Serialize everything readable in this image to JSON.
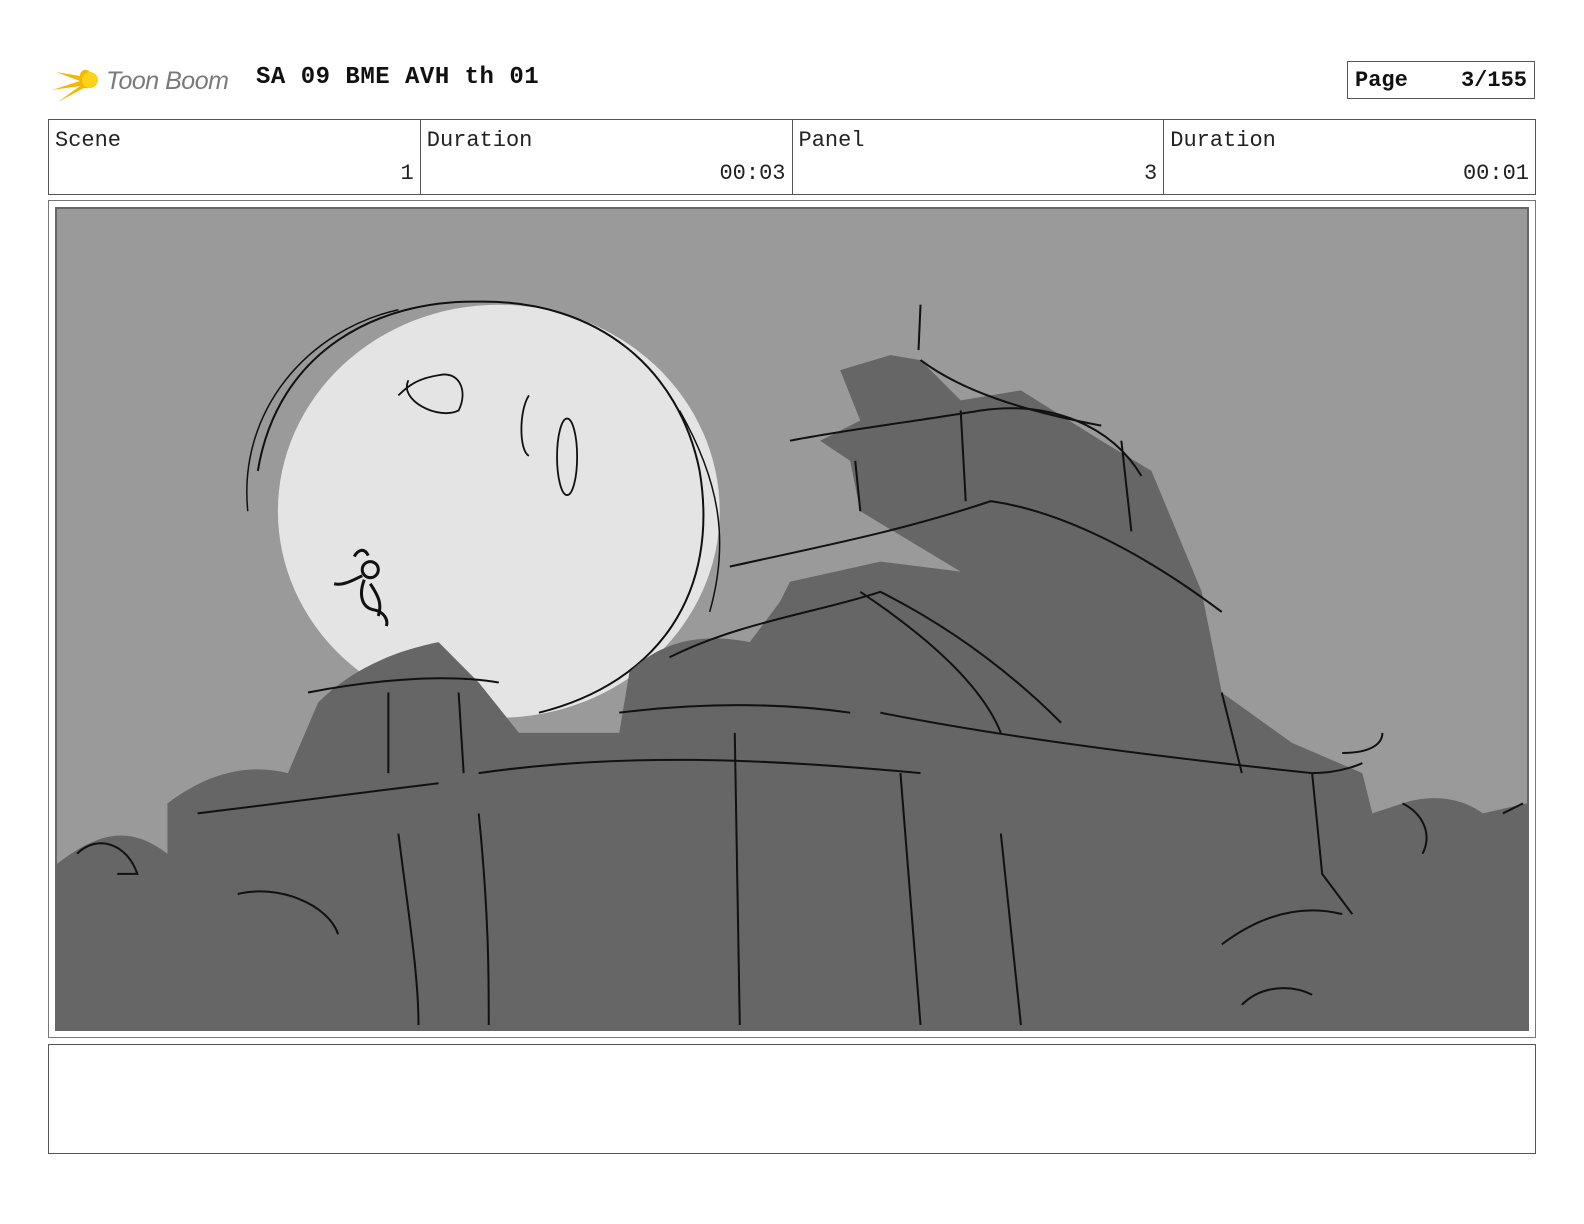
{
  "header": {
    "logo_text": "Toon Boom",
    "title": "SA 09 BME AVH th 01",
    "page_label": "Page",
    "page_value": "3/155"
  },
  "info": {
    "scene_label": "Scene",
    "scene_value": "1",
    "scene_duration_label": "Duration",
    "scene_duration_value": "00:03",
    "panel_label": "Panel",
    "panel_value": "3",
    "panel_duration_label": "Duration",
    "panel_duration_value": "00:01"
  },
  "notes": {
    "text": ""
  },
  "colors": {
    "sky": "#9a9a9a",
    "moon": "#e4e4e4",
    "castle": "#666666",
    "logo_yellow": "#f5b800"
  },
  "icons": [
    "toon-boom-logo-icon"
  ]
}
